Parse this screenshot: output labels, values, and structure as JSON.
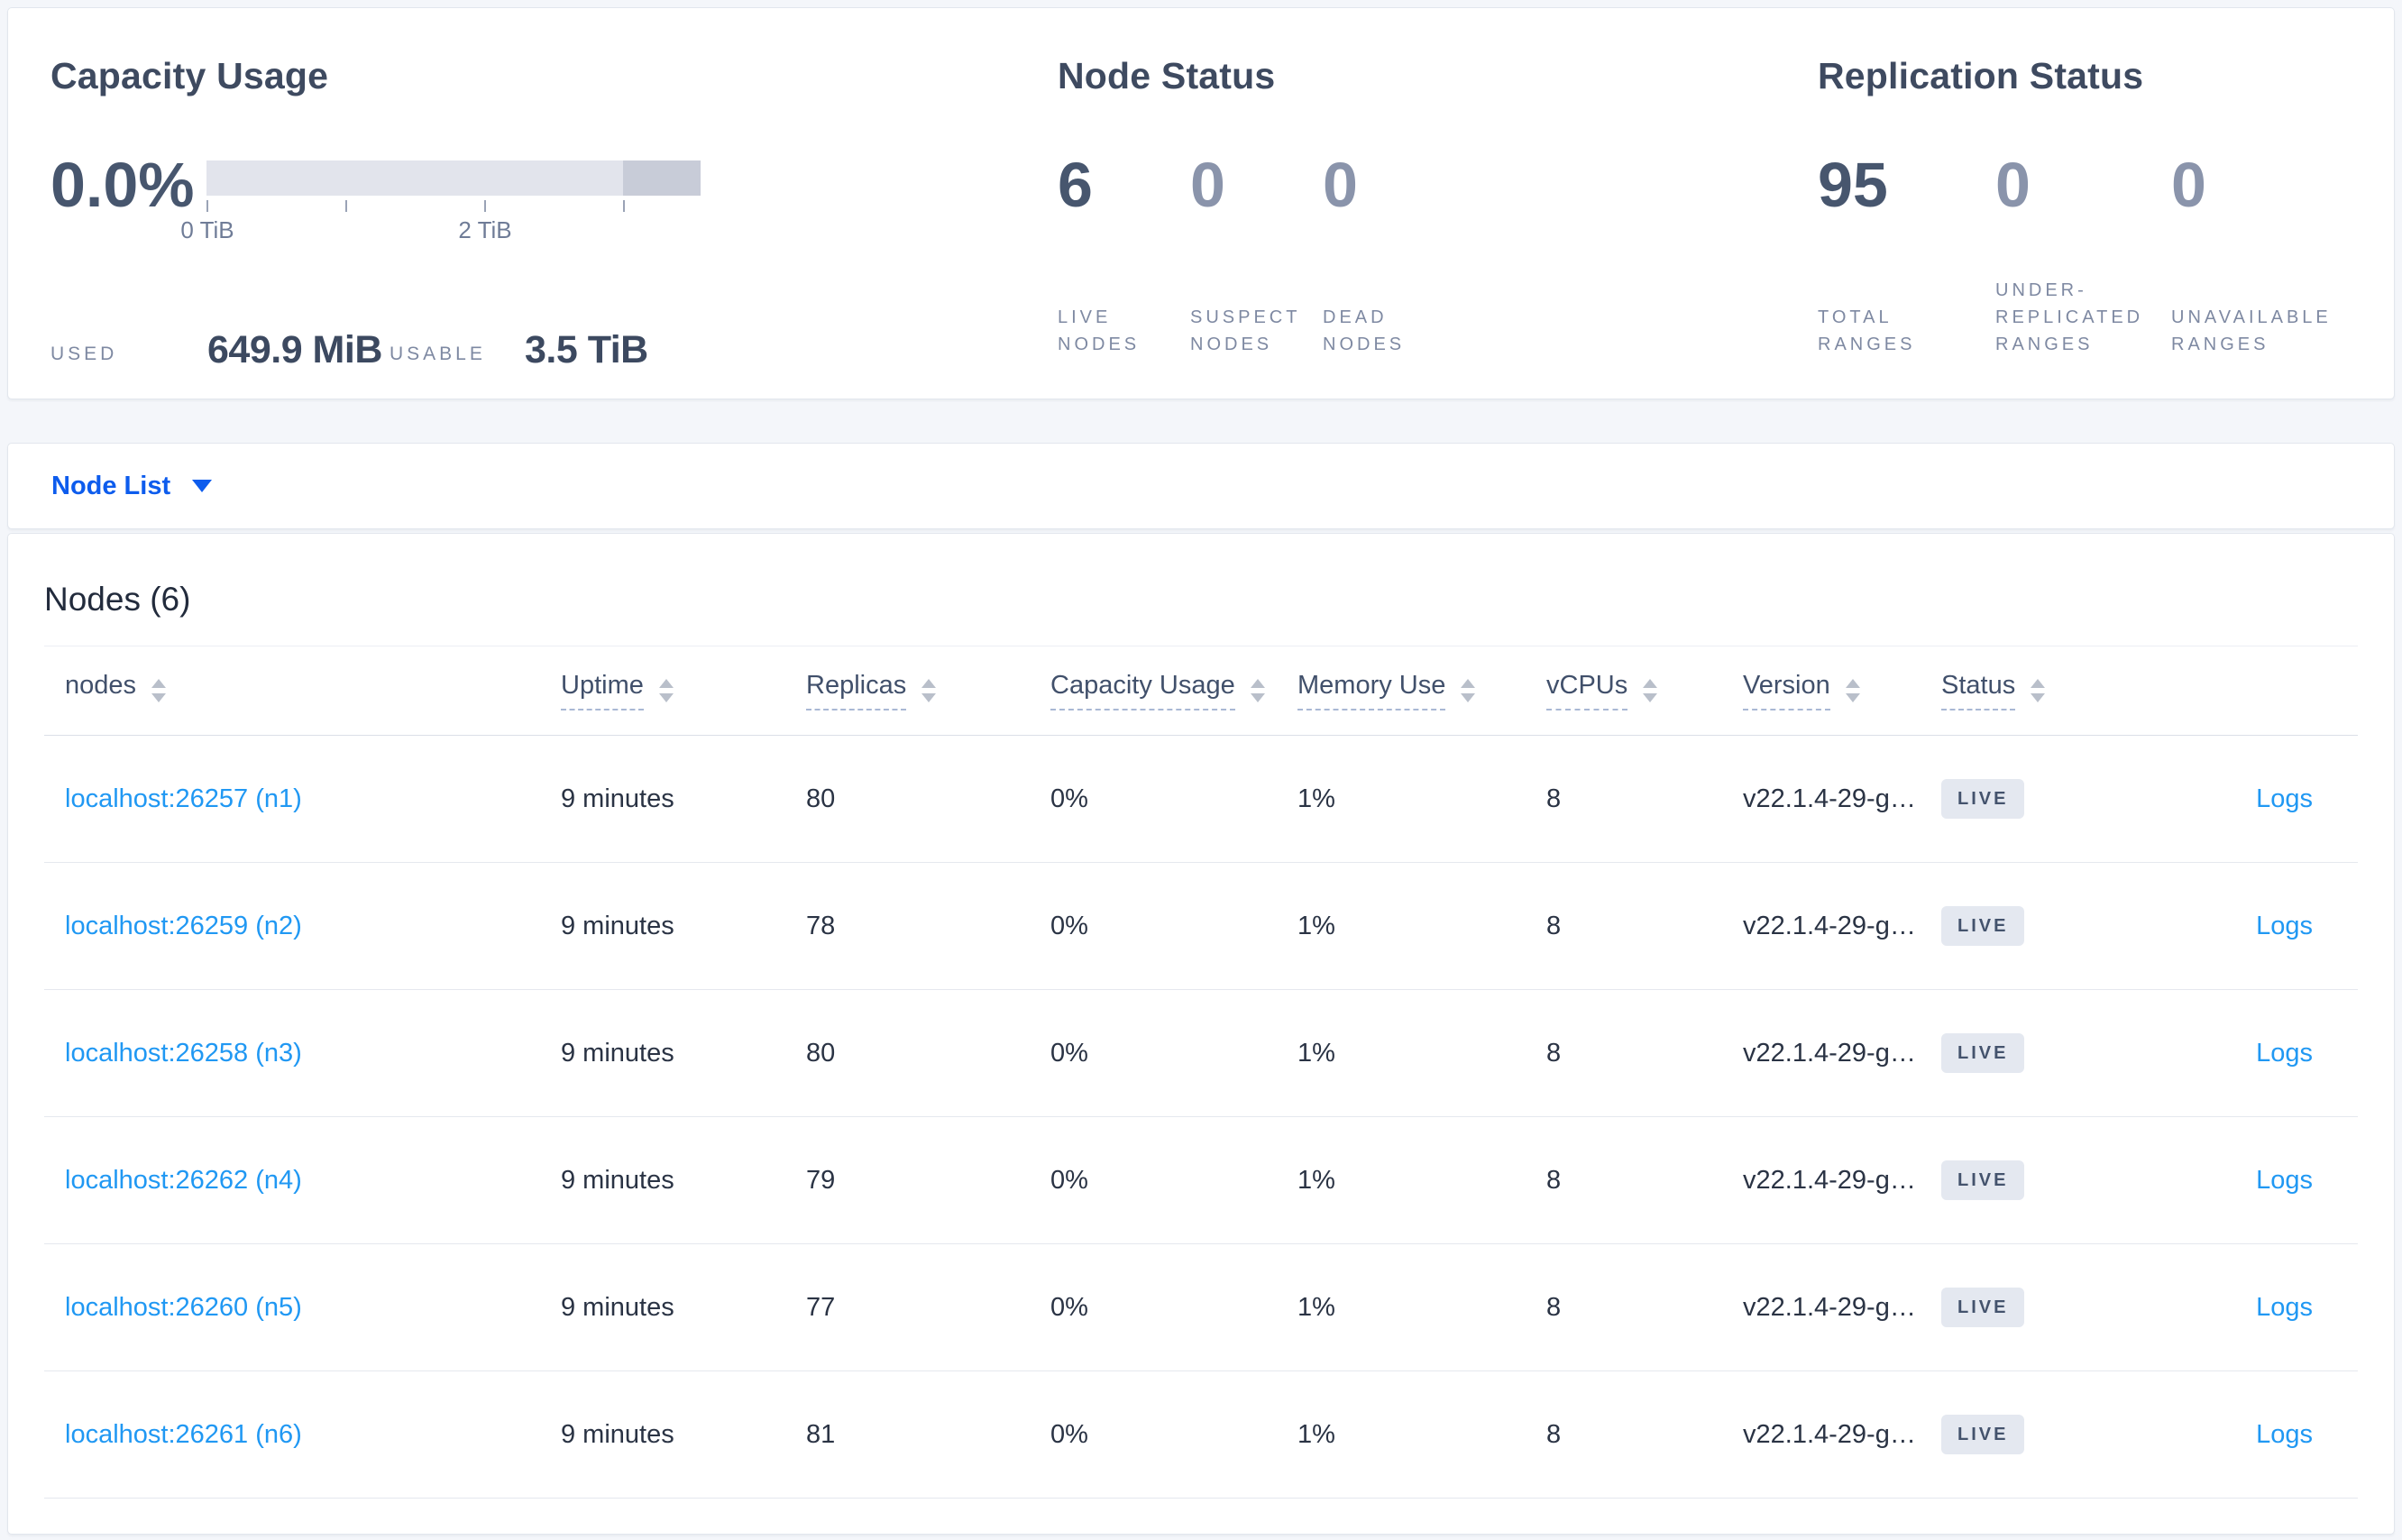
{
  "colors": {
    "page_background": "#f4f6fa",
    "accent_link_blue": "#2098f3",
    "selector_blue": "#0d5ced",
    "metric_dark": "#47566e",
    "metric_dim": "#8a94ab",
    "badge_background": "#e4e8f0",
    "capacity_bar_light": "#e2e4ec",
    "capacity_bar_dark": "#c8ccd8"
  },
  "summary": {
    "capacity": {
      "title": "Capacity Usage",
      "percent": "0.0%",
      "tick_labels": [
        "0 TiB",
        "2 TiB"
      ],
      "used_label": "USED",
      "used_value": "649.9 MiB",
      "usable_label": "USABLE",
      "usable_value": "3.5 TiB"
    },
    "node_status": {
      "title": "Node Status",
      "metrics": [
        {
          "value": "6",
          "label": "LIVE\nNODES"
        },
        {
          "value": "0",
          "label": "SUSPECT\nNODES"
        },
        {
          "value": "0",
          "label": "DEAD\nNODES"
        }
      ]
    },
    "replication": {
      "title": "Replication Status",
      "metrics": [
        {
          "value": "95",
          "label": "TOTAL\nRANGES"
        },
        {
          "value": "0",
          "label": "UNDER-\nREPLICATED\nRANGES"
        },
        {
          "value": "0",
          "label": "UNAVAILABLE\nRANGES"
        }
      ]
    }
  },
  "view_selector": {
    "label": "Node List"
  },
  "table": {
    "title": "Nodes (6)",
    "columns": [
      {
        "label": "nodes"
      },
      {
        "label": "Uptime"
      },
      {
        "label": "Replicas"
      },
      {
        "label": "Capacity Usage"
      },
      {
        "label": "Memory Use"
      },
      {
        "label": "vCPUs"
      },
      {
        "label": "Version"
      },
      {
        "label": "Status"
      }
    ],
    "rows": [
      {
        "node": "localhost:26257 (n1)",
        "uptime": "9 minutes",
        "replicas": "80",
        "capacity": "0%",
        "memory": "1%",
        "vcpus": "8",
        "version": "v22.1.4-29-g…",
        "status": "LIVE",
        "logs": "Logs"
      },
      {
        "node": "localhost:26259 (n2)",
        "uptime": "9 minutes",
        "replicas": "78",
        "capacity": "0%",
        "memory": "1%",
        "vcpus": "8",
        "version": "v22.1.4-29-g…",
        "status": "LIVE",
        "logs": "Logs"
      },
      {
        "node": "localhost:26258 (n3)",
        "uptime": "9 minutes",
        "replicas": "80",
        "capacity": "0%",
        "memory": "1%",
        "vcpus": "8",
        "version": "v22.1.4-29-g…",
        "status": "LIVE",
        "logs": "Logs"
      },
      {
        "node": "localhost:26262 (n4)",
        "uptime": "9 minutes",
        "replicas": "79",
        "capacity": "0%",
        "memory": "1%",
        "vcpus": "8",
        "version": "v22.1.4-29-g…",
        "status": "LIVE",
        "logs": "Logs"
      },
      {
        "node": "localhost:26260 (n5)",
        "uptime": "9 minutes",
        "replicas": "77",
        "capacity": "0%",
        "memory": "1%",
        "vcpus": "8",
        "version": "v22.1.4-29-g…",
        "status": "LIVE",
        "logs": "Logs"
      },
      {
        "node": "localhost:26261 (n6)",
        "uptime": "9 minutes",
        "replicas": "81",
        "capacity": "0%",
        "memory": "1%",
        "vcpus": "8",
        "version": "v22.1.4-29-g…",
        "status": "LIVE",
        "logs": "Logs"
      }
    ]
  }
}
